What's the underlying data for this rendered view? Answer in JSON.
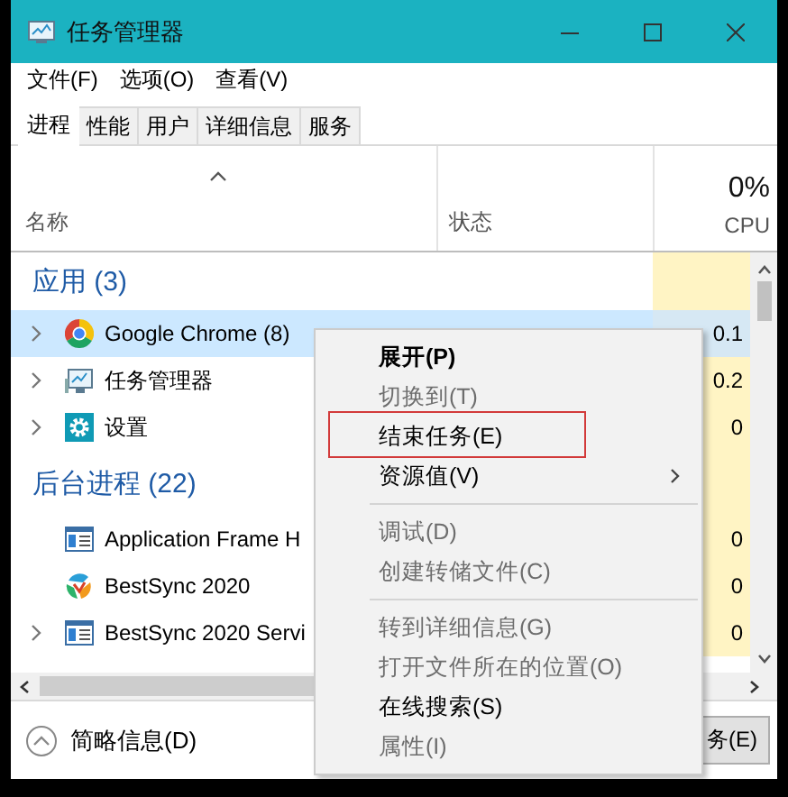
{
  "window": {
    "title": "任务管理器"
  },
  "menu_bar": [
    "文件(F)",
    "选项(O)",
    "查看(V)"
  ],
  "tabs": [
    {
      "label": "进程",
      "selected": true
    },
    {
      "label": "性能",
      "selected": false
    },
    {
      "label": "用户",
      "selected": false
    },
    {
      "label": "详细信息",
      "selected": false
    },
    {
      "label": "服务",
      "selected": false
    }
  ],
  "columns": {
    "name": "名称",
    "status": "状态",
    "cpu_total": "0%",
    "cpu": "CPU"
  },
  "groups": [
    {
      "title": "应用 (3)",
      "rows": [
        {
          "kind": "chrome",
          "name": "Google Chrome (8)",
          "expandable": true,
          "selected": true,
          "cpu": "0.1"
        },
        {
          "kind": "taskmgr",
          "name": "任务管理器",
          "expandable": true,
          "selected": false,
          "cpu": "0.2"
        },
        {
          "kind": "settings",
          "name": "设置",
          "expandable": true,
          "selected": false,
          "cpu": "0"
        }
      ]
    },
    {
      "title": "后台进程 (22)",
      "rows": [
        {
          "kind": "window",
          "name": "Application Frame H",
          "expandable": false,
          "selected": false,
          "cpu": "0"
        },
        {
          "kind": "sync",
          "name": "BestSync 2020",
          "expandable": false,
          "selected": false,
          "cpu": "0"
        },
        {
          "kind": "window",
          "name": "BestSync 2020 Servi",
          "expandable": true,
          "selected": false,
          "cpu": "0"
        }
      ]
    }
  ],
  "context_menu": {
    "items": [
      {
        "kind": "item",
        "label": "展开(P)",
        "default": true,
        "disabled": false,
        "submenu": false,
        "highlighted": false
      },
      {
        "kind": "item",
        "label": "切换到(T)",
        "default": false,
        "disabled": true,
        "submenu": false,
        "highlighted": false
      },
      {
        "kind": "item",
        "label": "结束任务(E)",
        "default": false,
        "disabled": false,
        "submenu": false,
        "highlighted": true
      },
      {
        "kind": "item",
        "label": "资源值(V)",
        "default": false,
        "disabled": false,
        "submenu": true,
        "highlighted": false
      },
      {
        "kind": "separator"
      },
      {
        "kind": "item",
        "label": "调试(D)",
        "default": false,
        "disabled": true,
        "submenu": false,
        "highlighted": false
      },
      {
        "kind": "item",
        "label": "创建转储文件(C)",
        "default": false,
        "disabled": true,
        "submenu": false,
        "highlighted": false
      },
      {
        "kind": "separator"
      },
      {
        "kind": "item",
        "label": "转到详细信息(G)",
        "default": false,
        "disabled": true,
        "submenu": false,
        "highlighted": false
      },
      {
        "kind": "item",
        "label": "打开文件所在的位置(O)",
        "default": false,
        "disabled": true,
        "submenu": false,
        "highlighted": false
      },
      {
        "kind": "item",
        "label": "在线搜索(S)",
        "default": false,
        "disabled": false,
        "submenu": false,
        "highlighted": false
      },
      {
        "kind": "item",
        "label": "属性(I)",
        "default": false,
        "disabled": true,
        "submenu": false,
        "highlighted": false
      }
    ]
  },
  "footer": {
    "details_label": "简略信息(D)",
    "end_task_button": "务(E)"
  }
}
